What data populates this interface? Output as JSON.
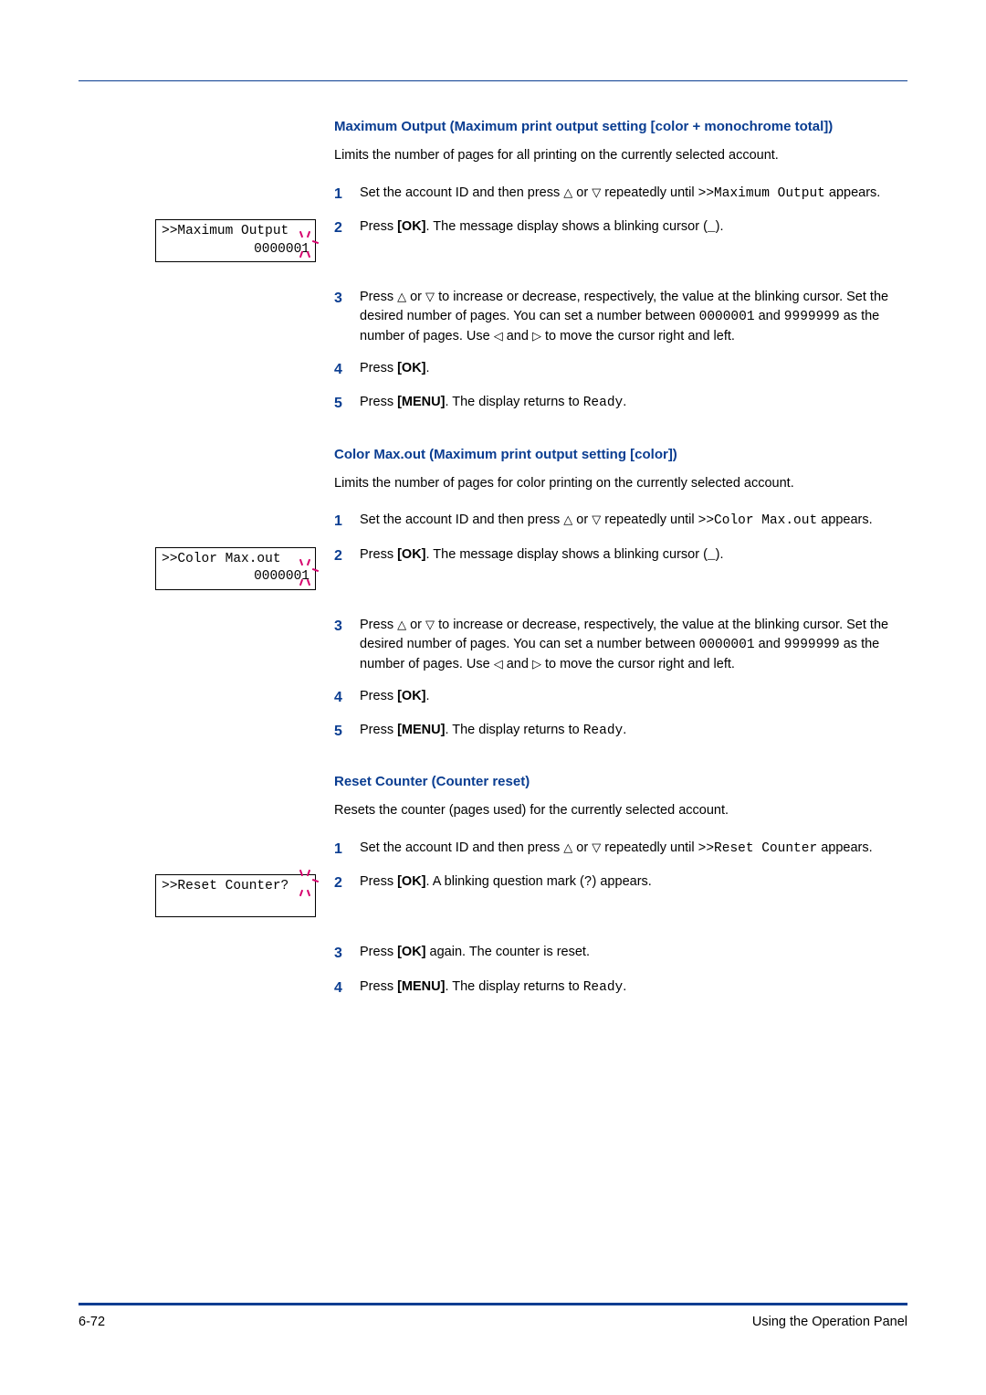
{
  "sections": [
    {
      "heading": "Maximum Output (Maximum print output setting [color + monochrome total])",
      "intro": "Limits the number of pages for all printing on the currently selected account.",
      "display": {
        "line1": ">>Maximum Output",
        "line2": "0000001",
        "type": "two"
      },
      "steps": [
        {
          "num": "1",
          "parts": [
            "Set the account ID and then press ",
            "△",
            " or ",
            "▽",
            " repeatedly until ",
            {
              "mono": ">>Maximum Output"
            },
            " appears."
          ]
        },
        {
          "num": "2",
          "parts": [
            "Press ",
            {
              "bold": "[OK]"
            },
            ". The message display shows a blinking cursor (",
            {
              "mono": "_"
            },
            ")."
          ]
        },
        {
          "num": "3",
          "parts": [
            "Press ",
            "△",
            " or ",
            "▽",
            " to increase or decrease, respectively, the value at the blinking cursor. Set the desired number of pages. You can set a number between ",
            {
              "mono": "0000001"
            },
            " and ",
            {
              "mono": "9999999"
            },
            " as the number of pages. Use ",
            "◁",
            " and ",
            "▷",
            " to move the cursor right and left."
          ]
        },
        {
          "num": "4",
          "parts": [
            "Press ",
            {
              "bold": "[OK]"
            },
            "."
          ]
        },
        {
          "num": "5",
          "parts": [
            "Press ",
            {
              "bold": "[MENU]"
            },
            ". The display returns to ",
            {
              "mono": "Ready"
            },
            "."
          ]
        }
      ]
    },
    {
      "heading": "Color Max.out (Maximum print output setting [color])",
      "intro": "Limits the number of pages for color printing on the currently selected account.",
      "display": {
        "line1": ">>Color Max.out",
        "line2": "0000001",
        "type": "two"
      },
      "steps": [
        {
          "num": "1",
          "parts": [
            "Set the account ID and then press ",
            "△",
            " or ",
            "▽",
            " repeatedly until ",
            {
              "mono": ">>Color Max.out"
            },
            " appears."
          ]
        },
        {
          "num": "2",
          "parts": [
            "Press ",
            {
              "bold": "[OK]"
            },
            ". The message display shows a blinking cursor (",
            {
              "mono": "_"
            },
            ")."
          ]
        },
        {
          "num": "3",
          "parts": [
            "Press ",
            "△",
            " or ",
            "▽",
            " to increase or decrease, respectively, the value at the blinking cursor. Set the desired number of pages. You can set a number between ",
            {
              "mono": "0000001"
            },
            " and ",
            {
              "mono": "9999999"
            },
            " as the number of pages. Use ",
            "◁",
            " and ",
            "▷",
            " to move the cursor right and left."
          ]
        },
        {
          "num": "4",
          "parts": [
            "Press ",
            {
              "bold": "[OK]"
            },
            "."
          ]
        },
        {
          "num": "5",
          "parts": [
            "Press ",
            {
              "bold": "[MENU]"
            },
            ". The display returns to ",
            {
              "mono": "Ready"
            },
            "."
          ]
        }
      ]
    },
    {
      "heading": "Reset Counter (Counter reset)",
      "intro": "Resets the counter (pages used) for the currently selected account.",
      "display": {
        "line1": ">>Reset Counter?",
        "line2": "",
        "type": "one"
      },
      "steps": [
        {
          "num": "1",
          "parts": [
            "Set the account ID and then press ",
            "△",
            " or ",
            "▽",
            " repeatedly until ",
            {
              "mono": ">>Reset Counter"
            },
            " appears."
          ]
        },
        {
          "num": "2",
          "parts": [
            "Press ",
            {
              "bold": "[OK]"
            },
            ". A blinking question mark (",
            {
              "mono": "?"
            },
            ") appears."
          ]
        },
        {
          "num": "3",
          "parts": [
            "Press ",
            {
              "bold": "[OK]"
            },
            " again. The counter is reset."
          ]
        },
        {
          "num": "4",
          "parts": [
            "Press ",
            {
              "bold": "[MENU]"
            },
            ". The display returns to ",
            {
              "mono": "Ready"
            },
            "."
          ]
        }
      ]
    }
  ],
  "footer": {
    "left": "6-72",
    "right": "Using the Operation Panel"
  }
}
